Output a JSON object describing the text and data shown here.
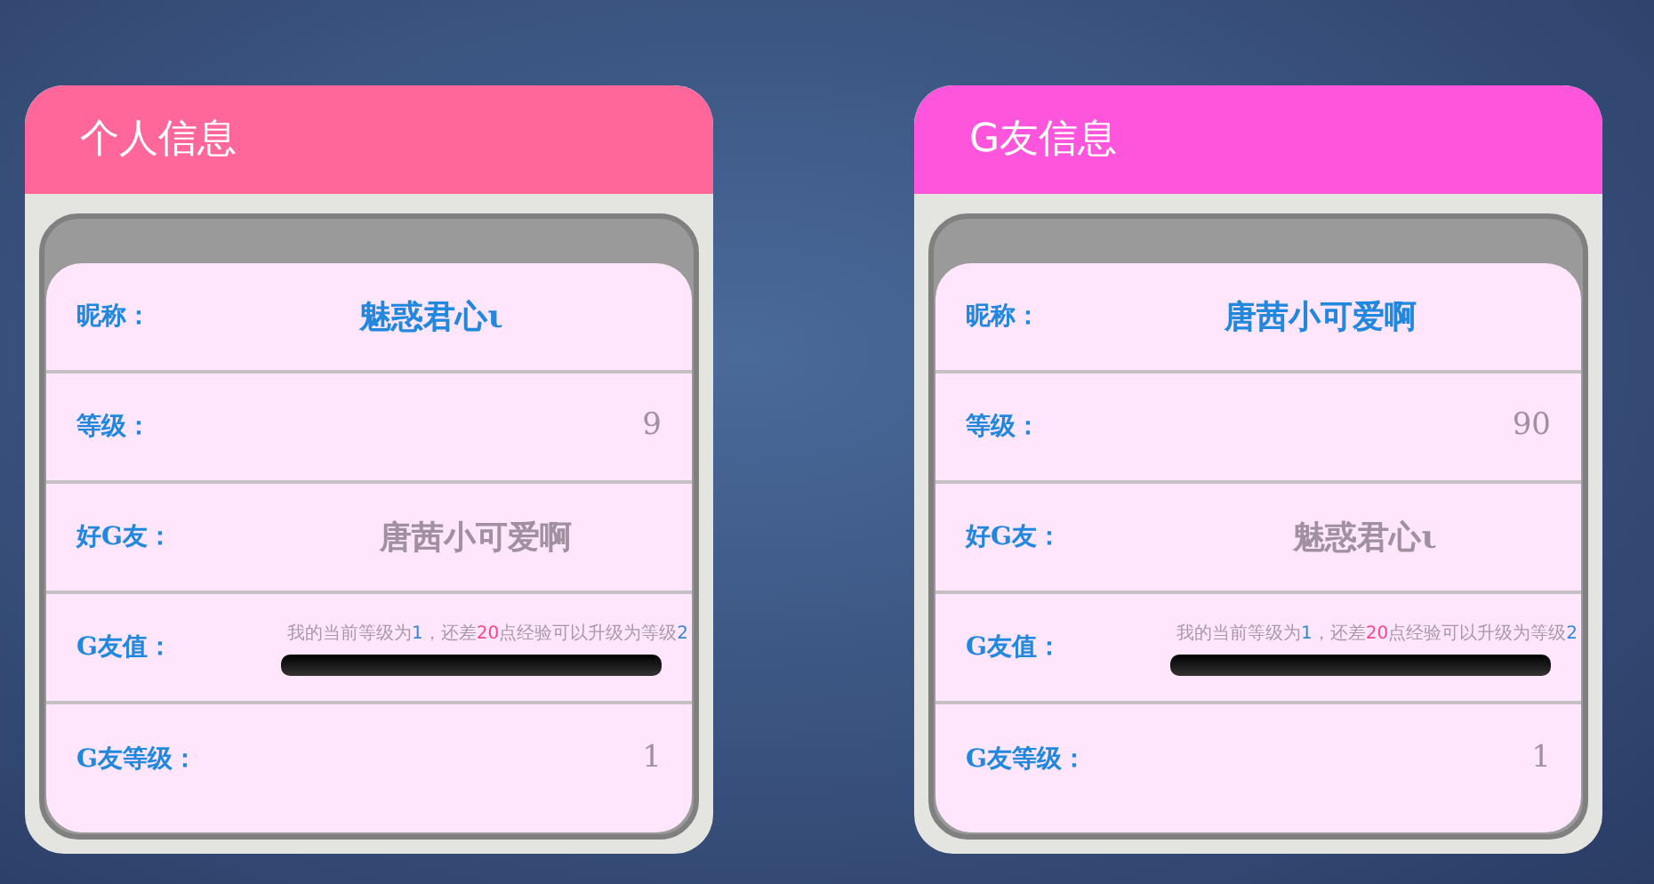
{
  "cards": [
    {
      "title": "个人信息",
      "color": "#ff6699",
      "rows": [
        {
          "kind": "name",
          "label": "昵称：",
          "value": "魅惑君心ι"
        },
        {
          "kind": "number",
          "label": "等级：",
          "value": "9"
        },
        {
          "kind": "friend",
          "label": "好G友：",
          "value": "唐茜小可爱啊"
        },
        {
          "kind": "progress",
          "label": "G友值：",
          "level": 0,
          "message": [
            {
              "kind": "text",
              "text": "我的当前等级为"
            },
            {
              "kind": "level",
              "text": "1"
            },
            {
              "kind": "text",
              "text": "，还差"
            },
            {
              "kind": "points",
              "text": "20"
            },
            {
              "kind": "text",
              "text": "点经验可以升级为等级"
            },
            {
              "kind": "level",
              "text": "2"
            }
          ]
        },
        {
          "kind": "number",
          "label": "G友等级：",
          "value": "1"
        }
      ]
    },
    {
      "title": "G友信息",
      "color": "#ff55dd",
      "rows": [
        {
          "kind": "name",
          "label": "昵称：",
          "value": "唐茜小可爱啊"
        },
        {
          "kind": "number",
          "label": "等级：",
          "value": "90"
        },
        {
          "kind": "friend",
          "label": "好G友：",
          "value": "魅惑君心ι"
        },
        {
          "kind": "progress",
          "label": "G友值：",
          "level": 0,
          "message": [
            {
              "kind": "text",
              "text": "我的当前等级为"
            },
            {
              "kind": "level",
              "text": "1"
            },
            {
              "kind": "text",
              "text": "，还差"
            },
            {
              "kind": "points",
              "text": "20"
            },
            {
              "kind": "text",
              "text": "点经验可以升级为等级"
            },
            {
              "kind": "level",
              "text": "2"
            }
          ]
        },
        {
          "kind": "number",
          "label": "G友等级：",
          "value": "1"
        }
      ]
    }
  ]
}
